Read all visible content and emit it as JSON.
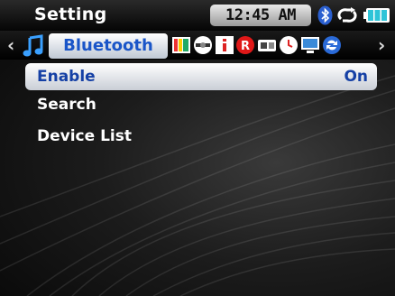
{
  "statusbar": {
    "title": "Setting",
    "time": "12:45 AM",
    "icons": [
      "bluetooth-icon",
      "repeat-icon",
      "battery-icon"
    ]
  },
  "tabbar": {
    "active_label": "Bluetooth",
    "icons": [
      "music-note-icon",
      "display-icon",
      "disc-icon",
      "info-icon",
      "record-icon",
      "memory-card-icon",
      "clock-icon",
      "monitor-icon",
      "sync-icon"
    ]
  },
  "menu": {
    "items": [
      {
        "label": "Enable",
        "value": "On"
      },
      {
        "label": "Search"
      },
      {
        "label": "Device List"
      }
    ]
  },
  "colors": {
    "accent_text": "#1a55c8",
    "highlight": "#e8ecf2"
  }
}
